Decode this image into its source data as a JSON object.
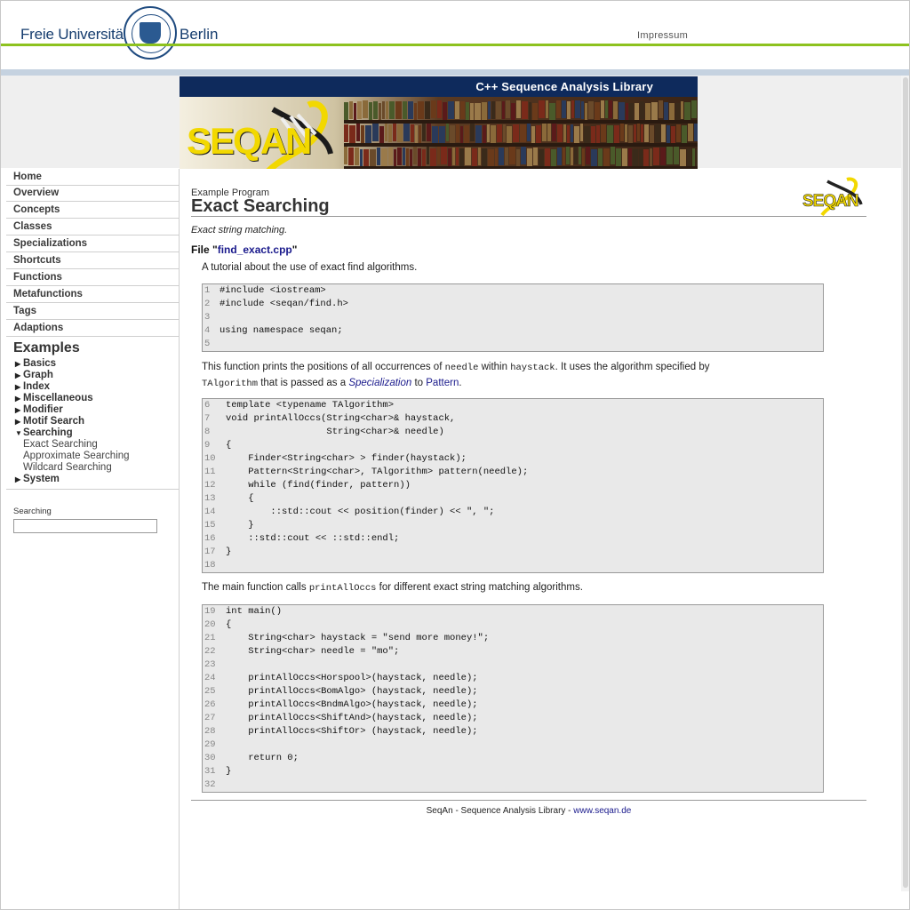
{
  "fu_header": {
    "logo_left": "Freie Universität",
    "logo_right": "Berlin",
    "impressum": "Impressum"
  },
  "banner": {
    "title": "C++ Sequence Analysis Library",
    "logo_text": "SEQAN"
  },
  "sidebar": {
    "nav": [
      "Home",
      "Overview",
      "Concepts",
      "Classes",
      "Specializations",
      "Shortcuts",
      "Functions",
      "Metafunctions",
      "Tags",
      "Adaptions"
    ],
    "examples_title": "Examples",
    "examples": [
      {
        "label": "Basics",
        "expanded": false
      },
      {
        "label": "Graph",
        "expanded": false
      },
      {
        "label": "Index",
        "expanded": false
      },
      {
        "label": "Miscellaneous",
        "expanded": false
      },
      {
        "label": "Modifier",
        "expanded": false
      },
      {
        "label": "Motif Search",
        "expanded": false
      },
      {
        "label": "Searching",
        "expanded": true
      },
      {
        "label": "System",
        "expanded": false
      }
    ],
    "searching_children": [
      "Exact Searching",
      "Approximate Searching",
      "Wildcard Searching"
    ],
    "search_label": "Searching",
    "search_value": ""
  },
  "content": {
    "program_label": "Example Program",
    "title": "Exact Searching",
    "small_logo_text": "SEQAN",
    "subtitle": "Exact string matching.",
    "file_prefix": "File \"",
    "file_name": "find_exact.cpp",
    "file_suffix": "\"",
    "para1": "A tutorial about the use of exact find algorithms.",
    "para2": {
      "t1": "This function prints the positions of all occurrences of ",
      "c1": "needle",
      "t2": " within ",
      "c2": "haystack",
      "t3": ". It uses the algorithm specified by",
      "c3": "TAlgorithm",
      "t4": " that is passed as a ",
      "l1": "Specialization",
      "t5": " to ",
      "l2": "Pattern",
      "t6": "."
    },
    "para3": {
      "t1": "The main function calls ",
      "c1": "printAllOccs",
      "t2": " for different exact string matching algorithms."
    },
    "code1": [
      [
        "1",
        "#include <iostream>"
      ],
      [
        "2",
        "#include <seqan/find.h>"
      ],
      [
        "3",
        ""
      ],
      [
        "4",
        "using namespace seqan;"
      ],
      [
        "5",
        ""
      ]
    ],
    "code2": [
      [
        "6",
        "template <typename TAlgorithm>"
      ],
      [
        "7",
        "void printAllOccs(String<char>& haystack,"
      ],
      [
        "8",
        "                  String<char>& needle)"
      ],
      [
        "9",
        "{"
      ],
      [
        "10",
        "    Finder<String<char> > finder(haystack);"
      ],
      [
        "11",
        "    Pattern<String<char>, TAlgorithm> pattern(needle);"
      ],
      [
        "12",
        "    while (find(finder, pattern))"
      ],
      [
        "13",
        "    {"
      ],
      [
        "14",
        "        ::std::cout << position(finder) << \", \";"
      ],
      [
        "15",
        "    }"
      ],
      [
        "16",
        "    ::std::cout << ::std::endl;"
      ],
      [
        "17",
        "}"
      ],
      [
        "18",
        ""
      ]
    ],
    "code3": [
      [
        "19",
        "int main()"
      ],
      [
        "20",
        "{"
      ],
      [
        "21",
        "    String<char> haystack = \"send more money!\";"
      ],
      [
        "22",
        "    String<char> needle = \"mo\";"
      ],
      [
        "23",
        ""
      ],
      [
        "24",
        "    printAllOccs<Horspool>(haystack, needle);"
      ],
      [
        "25",
        "    printAllOccs<BomAlgo> (haystack, needle);"
      ],
      [
        "26",
        "    printAllOccs<BndmAlgo>(haystack, needle);"
      ],
      [
        "27",
        "    printAllOccs<ShiftAnd>(haystack, needle);"
      ],
      [
        "28",
        "    printAllOccs<ShiftOr> (haystack, needle);"
      ],
      [
        "29",
        ""
      ],
      [
        "30",
        "    return 0;"
      ],
      [
        "31",
        "}"
      ],
      [
        "32",
        ""
      ]
    ],
    "footer_text": "SeqAn - Sequence Analysis Library - ",
    "footer_link": "www.seqan.de"
  },
  "colors": {
    "accent_green": "#8dc21f",
    "banner_blue": "#0e2a5c",
    "link_blue": "#1a1a8c",
    "seqan_yellow": "#f2d800"
  }
}
